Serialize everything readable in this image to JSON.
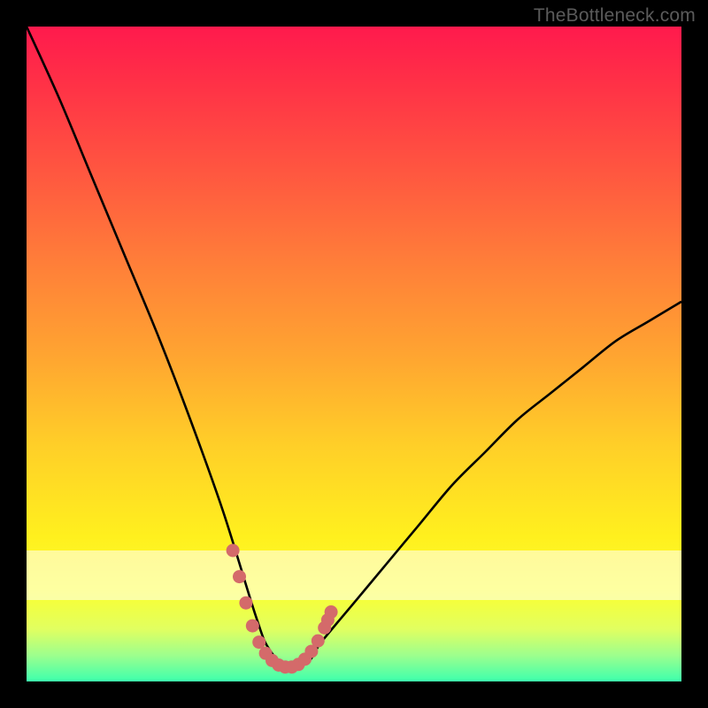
{
  "watermark": "TheBottleneck.com",
  "chart_data": {
    "type": "line",
    "title": "",
    "xlabel": "",
    "ylabel": "",
    "xlim": [
      0,
      100
    ],
    "ylim": [
      0,
      100
    ],
    "grid": false,
    "legend": false,
    "series": [
      {
        "name": "main-curve",
        "color": "#000000",
        "x": [
          0,
          5,
          10,
          15,
          20,
          25,
          30,
          35,
          37,
          40,
          43,
          45,
          50,
          55,
          60,
          65,
          70,
          75,
          80,
          85,
          90,
          95,
          100
        ],
        "values": [
          100,
          89,
          77,
          65,
          53,
          40,
          26,
          10,
          5,
          2,
          3,
          6,
          12,
          18,
          24,
          30,
          35,
          40,
          44,
          48,
          52,
          55,
          58
        ]
      },
      {
        "name": "highlight-dots",
        "color": "#d46a6a",
        "x": [
          31.5,
          32.5,
          33.5,
          34.5,
          35.5,
          36.5,
          37.5,
          38.5,
          39.5,
          40.5,
          41.5,
          42.5,
          43.5,
          44.5,
          45.5,
          46.0,
          46.5
        ],
        "values": [
          20,
          16,
          12,
          8.5,
          6,
          4.3,
          3.2,
          2.5,
          2.2,
          2.2,
          2.6,
          3.4,
          4.6,
          6.2,
          8.2,
          9.4,
          10.6
        ]
      }
    ],
    "background_gradient": {
      "stops": [
        {
          "pos": 0.0,
          "color": "#ff1a4d"
        },
        {
          "pos": 0.5,
          "color": "#ffa431"
        },
        {
          "pos": 0.8,
          "color": "#fff01e"
        },
        {
          "pos": 1.0,
          "color": "#3dffad"
        }
      ],
      "highlight_band": {
        "from": 0.8,
        "to": 0.875,
        "opacity": 0.55
      }
    }
  }
}
